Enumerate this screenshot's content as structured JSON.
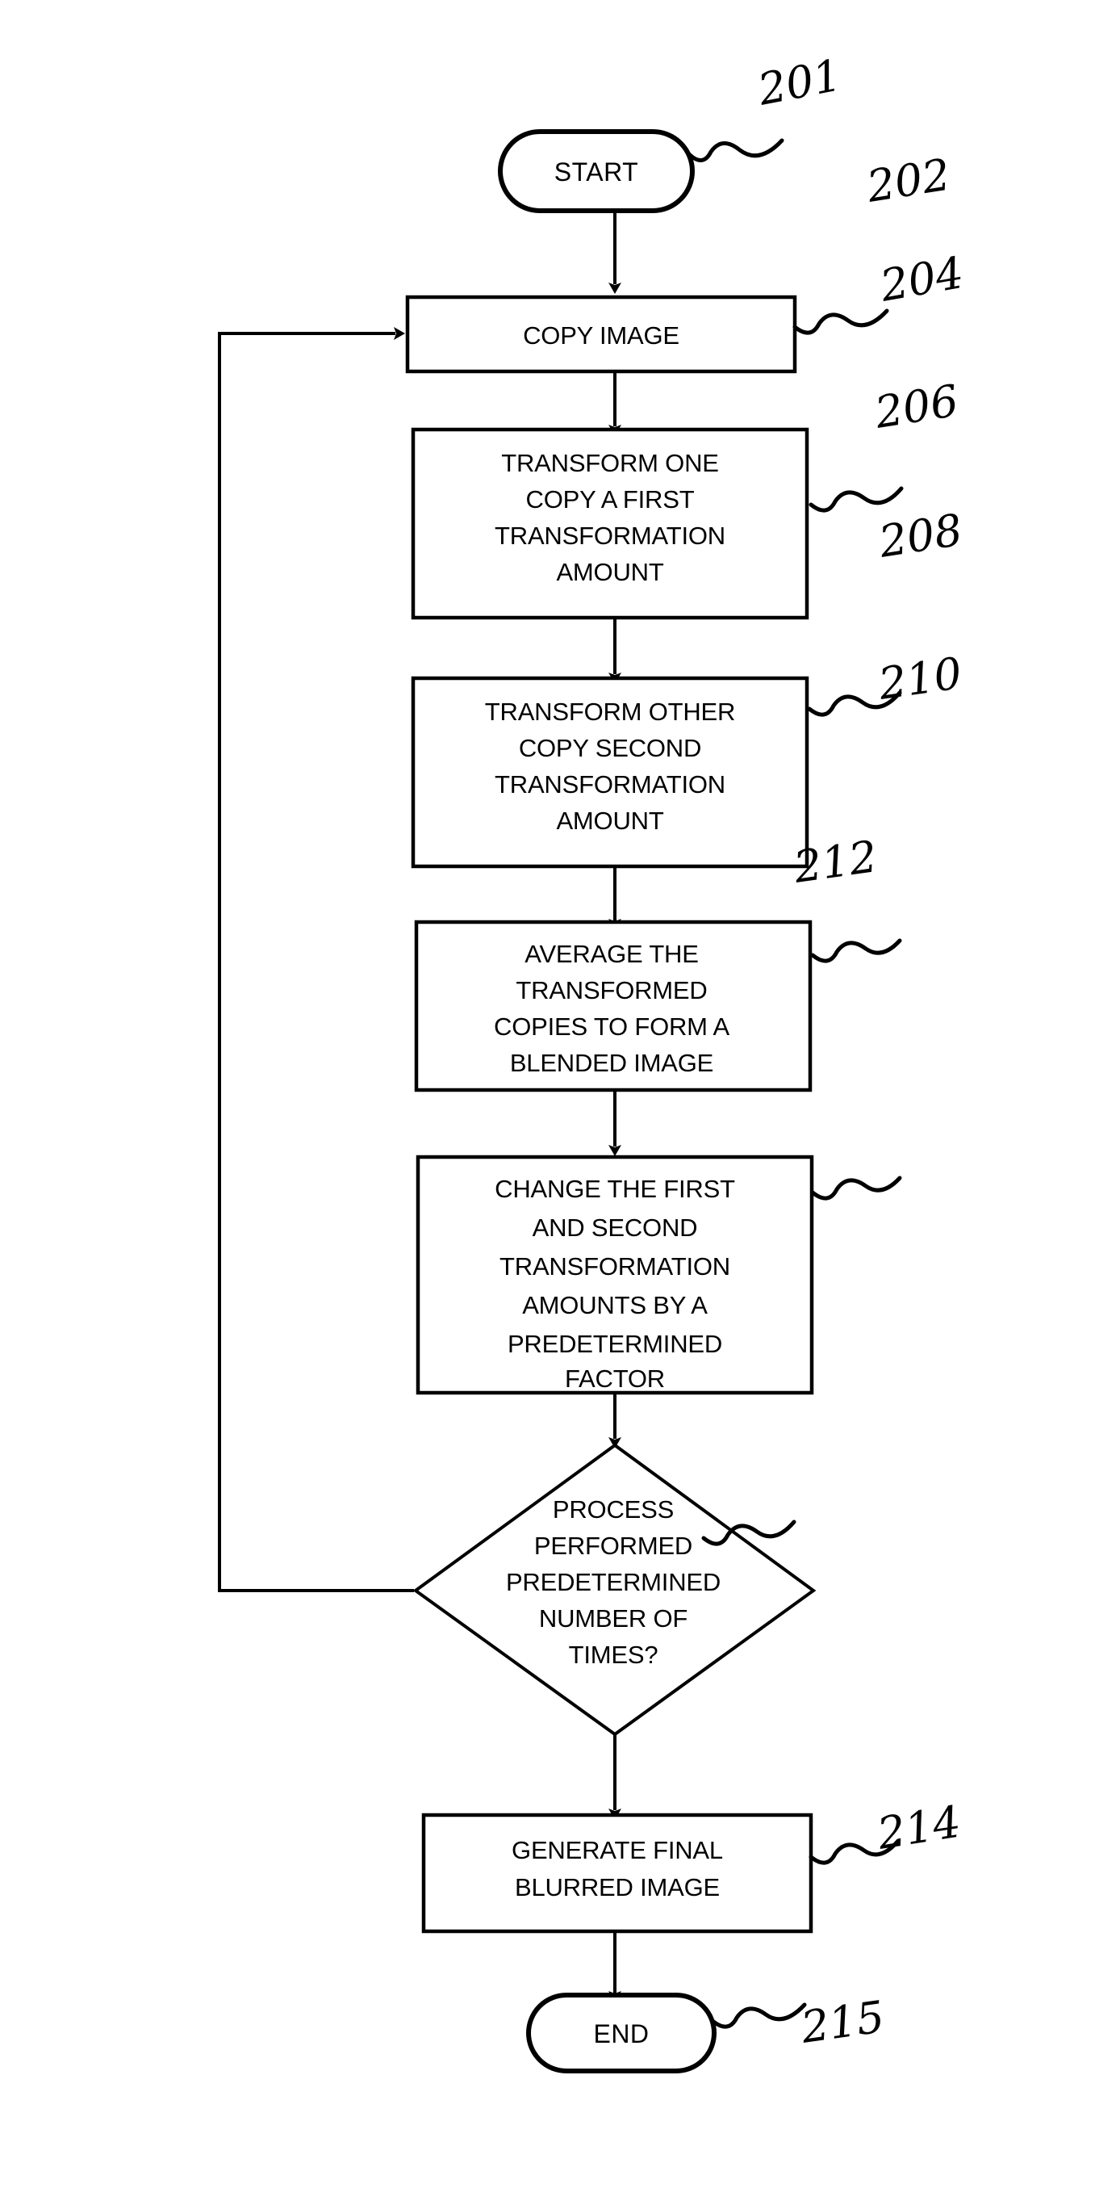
{
  "figure": {
    "type": "process-flowchart",
    "background_color": "#ffffff",
    "line_color": "#000000"
  },
  "nodes": {
    "start": {
      "ref": "201",
      "shape": "terminator",
      "text": "START"
    },
    "copy_image": {
      "ref": "202",
      "shape": "process",
      "lines": [
        "COPY IMAGE"
      ]
    },
    "transform_one": {
      "ref": "204",
      "shape": "process",
      "lines": [
        "TRANSFORM ONE",
        "COPY A FIRST",
        "TRANSFORMATION",
        "AMOUNT"
      ]
    },
    "transform_other": {
      "ref": "206",
      "shape": "process",
      "lines": [
        "TRANSFORM OTHER",
        "COPY SECOND",
        "TRANSFORMATION",
        "AMOUNT"
      ]
    },
    "average": {
      "ref": "208",
      "shape": "process",
      "lines": [
        "AVERAGE THE",
        "TRANSFORMED",
        "COPIES TO FORM A",
        "BLENDED IMAGE"
      ]
    },
    "change_amounts": {
      "ref": "210",
      "shape": "process",
      "lines": [
        "CHANGE THE FIRST",
        "AND SECOND",
        "TRANSFORMATION",
        "AMOUNTS BY A",
        "PREDETERMINED",
        "FACTOR"
      ]
    },
    "decision": {
      "ref": "212",
      "shape": "decision",
      "lines": [
        "PROCESS",
        "PERFORMED",
        "PREDETERMINED",
        "NUMBER OF",
        "TIMES?"
      ]
    },
    "generate_final": {
      "ref": "214",
      "shape": "process",
      "lines": [
        "GENERATE FINAL",
        "BLURRED IMAGE"
      ]
    },
    "end": {
      "ref": "215",
      "shape": "terminator",
      "text": "END"
    }
  },
  "edges": [
    {
      "from": "start",
      "to": "copy_image",
      "kind": "down-arrow"
    },
    {
      "from": "copy_image",
      "to": "transform_one",
      "kind": "down-arrow"
    },
    {
      "from": "transform_one",
      "to": "transform_other",
      "kind": "down-arrow"
    },
    {
      "from": "transform_other",
      "to": "average",
      "kind": "down-arrow"
    },
    {
      "from": "average",
      "to": "change_amounts",
      "kind": "down-arrow"
    },
    {
      "from": "change_amounts",
      "to": "decision",
      "kind": "down-arrow"
    },
    {
      "from": "decision",
      "to": "generate_final",
      "kind": "down-arrow"
    },
    {
      "from": "generate_final",
      "to": "end",
      "kind": "down-arrow"
    },
    {
      "from": "decision",
      "to": "copy_image",
      "kind": "feedback-loop-left"
    }
  ],
  "ref_labels": {
    "start": "201",
    "copy_image": "202",
    "transform_one": "204",
    "transform_other": "206",
    "average": "208",
    "change_amounts": "210",
    "decision": "212",
    "generate_final": "214",
    "end": "215"
  }
}
